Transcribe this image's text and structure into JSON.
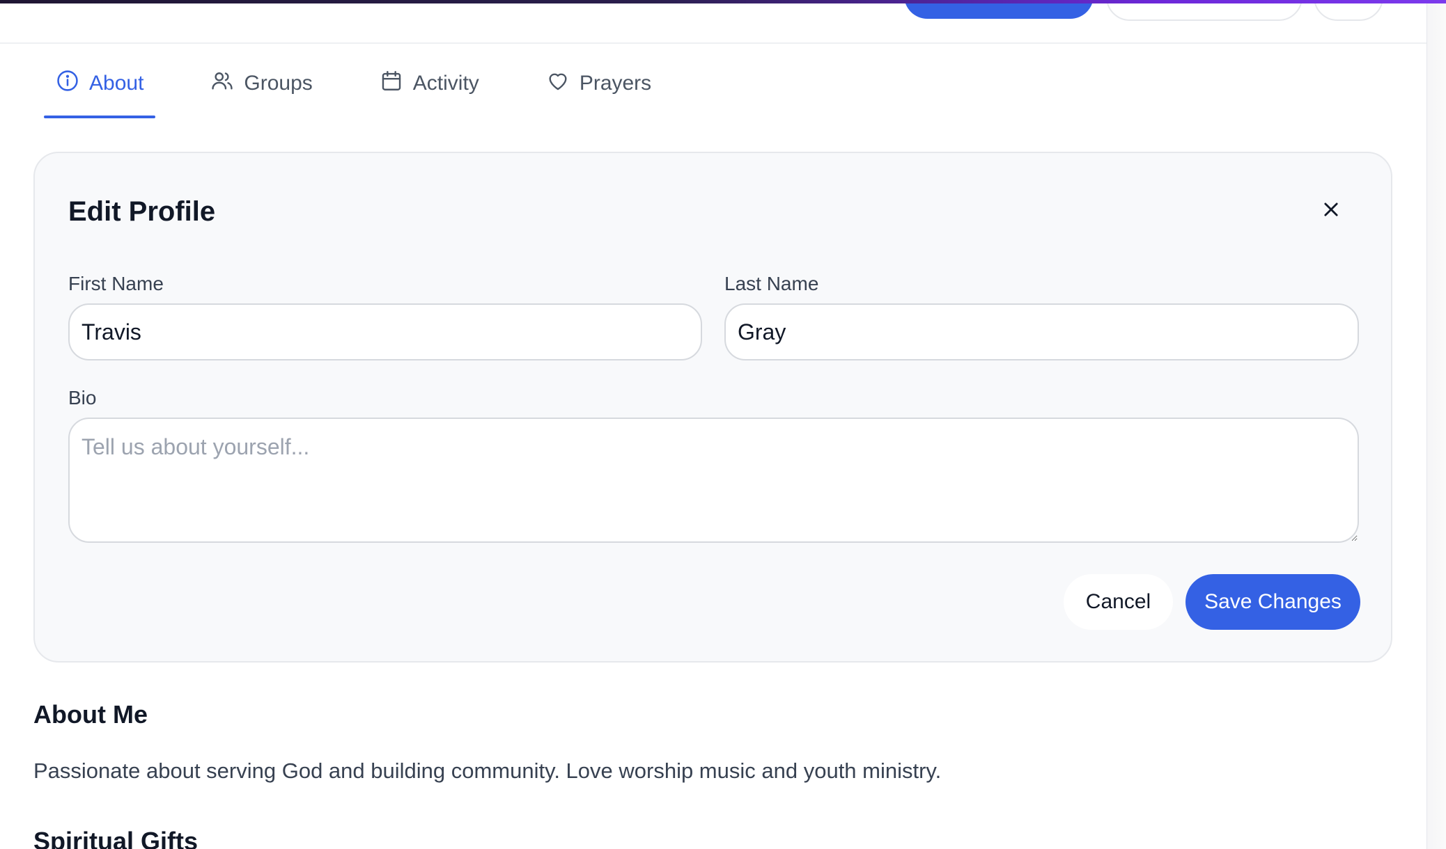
{
  "tabs": [
    {
      "label": "About",
      "icon": "info-icon",
      "active": true
    },
    {
      "label": "Groups",
      "icon": "users-icon",
      "active": false
    },
    {
      "label": "Activity",
      "icon": "calendar-icon",
      "active": false
    },
    {
      "label": "Prayers",
      "icon": "heart-icon",
      "active": false
    }
  ],
  "edit_profile": {
    "title": "Edit Profile",
    "first_name_label": "First Name",
    "first_name_value": "Travis",
    "last_name_label": "Last Name",
    "last_name_value": "Gray",
    "bio_label": "Bio",
    "bio_placeholder": "Tell us about yourself...",
    "bio_value": "",
    "cancel_label": "Cancel",
    "save_label": "Save Changes"
  },
  "about_me": {
    "heading": "About Me",
    "text": "Passionate about serving God and building community. Love worship music and youth ministry."
  },
  "spiritual_gifts": {
    "heading": "Spiritual Gifts"
  },
  "colors": {
    "accent": "#3461e4",
    "card_background": "#f8f9fb",
    "top_strip_end": "#7c3aed"
  }
}
